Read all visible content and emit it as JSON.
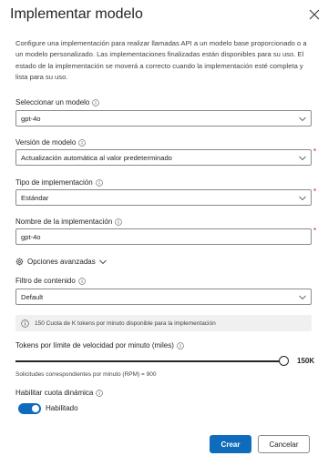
{
  "panel": {
    "title": "Implementar modelo",
    "description": "Configure una implementación para realizar llamadas API a un modelo base proporcionado o a un modelo personalizado. Las implementaciones finalizadas están disponibles para su uso. El estado de la implementación se moverá a correcto cuando la implementación esté completa y lista para su uso."
  },
  "fields": {
    "model": {
      "label": "Seleccionar un modelo",
      "value": "gpt-4o"
    },
    "model_version": {
      "label": "Versión de modelo",
      "value": "Actualización automática al valor predeterminado",
      "required": true
    },
    "deployment_type": {
      "label": "Tipo de implementación",
      "value": "Estándar",
      "required": true
    },
    "deployment_name": {
      "label": "Nombre de la implementación",
      "value": "gpt-4o",
      "required": true
    },
    "advanced_options": {
      "label": "Opciones avanzadas"
    },
    "content_filter": {
      "label": "Filtro de contenido",
      "value": "Default"
    }
  },
  "quota_info": "150 Cuota de K tokens por minuto disponible para la implementación",
  "rate_limit": {
    "label": "Tokens por límite de velocidad por minuto (miles)",
    "value_label": "150K",
    "level_fraction": 1.0,
    "rpm_text": "Solicitudes correspondientes por minuto (RPM) = 900"
  },
  "dynamic_quota": {
    "label": "Habilitar cuota dinámica",
    "toggle_label": "Habilitado",
    "enabled": true
  },
  "buttons": {
    "create": "Crear",
    "cancel": "Cancelar"
  },
  "required_mark": "*",
  "colors": {
    "primary": "#0f6cbd",
    "required": "#c50f1f"
  }
}
